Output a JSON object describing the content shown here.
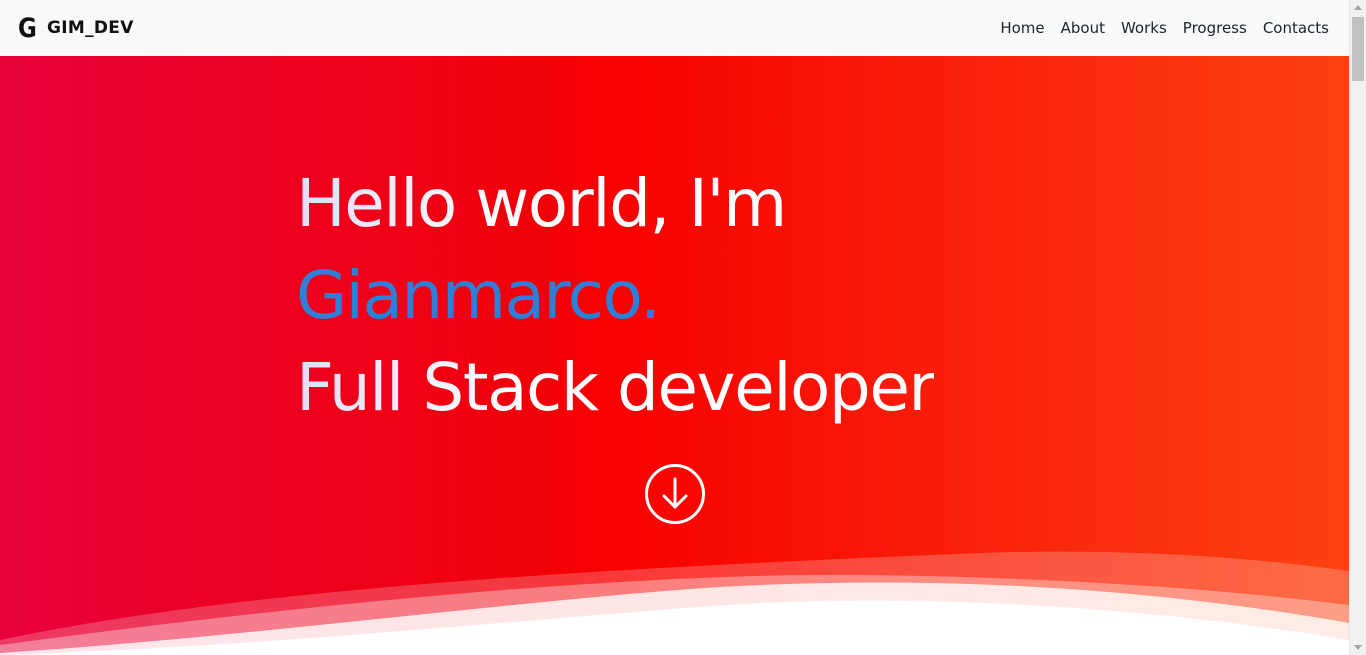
{
  "navbar": {
    "brand_logo": "G",
    "brand_text": "GIM_DEV",
    "links": [
      {
        "label": "Home"
      },
      {
        "label": "About"
      },
      {
        "label": "Works"
      },
      {
        "label": "Progress"
      },
      {
        "label": "Contacts"
      }
    ]
  },
  "hero": {
    "line1": "Hello world, I'm",
    "name": "Gianmarco.",
    "line3": "Full Stack developer",
    "scroll_icon": "arrow-down-circle-icon"
  },
  "colors": {
    "hero_gradient_start": "#e8003a",
    "hero_gradient_mid": "#f80000",
    "hero_gradient_end": "#fc4110",
    "name_color": "#2f7fd6",
    "navbar_bg": "#f8f9fa"
  }
}
